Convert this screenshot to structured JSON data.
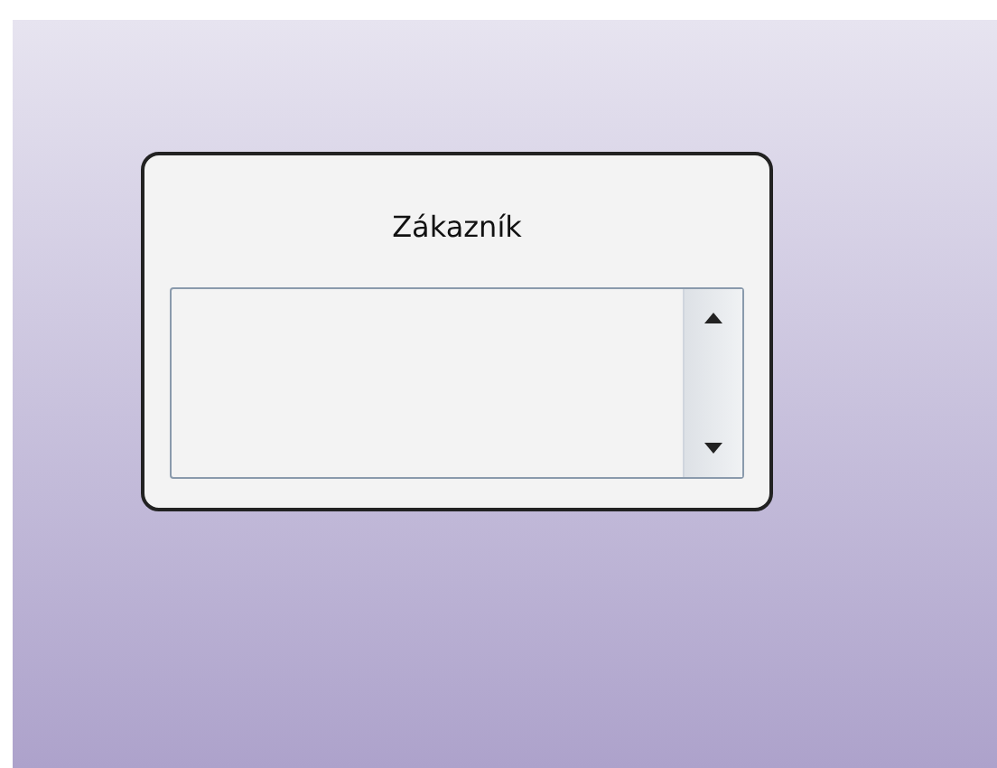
{
  "card": {
    "title": "Zákazník"
  }
}
